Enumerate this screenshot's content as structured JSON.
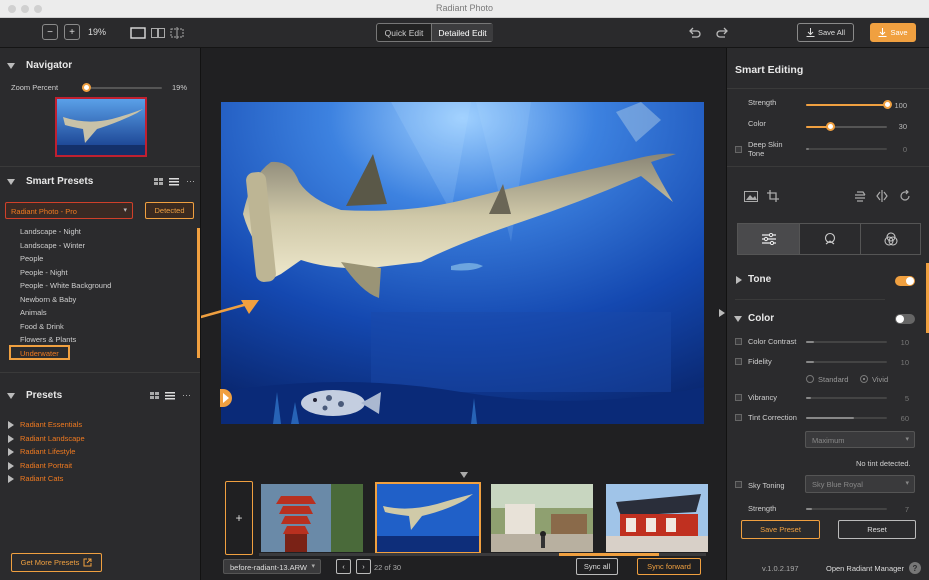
{
  "window": {
    "title": "Radiant Photo"
  },
  "toolbar": {
    "zoom_minus": "−",
    "zoom_plus": "+",
    "zoom_value": "19%",
    "tabs": [
      {
        "label": "Quick Edit"
      },
      {
        "label": "Detailed Edit"
      }
    ],
    "save_all_label": "Save All",
    "save_label": "Save"
  },
  "navigator": {
    "title": "Navigator",
    "zoom_label": "Zoom Percent",
    "zoom_value": "19%",
    "zoom_fraction": 0.19
  },
  "smart_presets": {
    "title": "Smart Presets",
    "dropdown_value": "Radiant Photo - Pro",
    "detected_label": "Detected",
    "items": [
      "Landscape - Night",
      "Landscape - Winter",
      "People",
      "People - Night",
      "People - White Background",
      "Newborn & Baby",
      "Animals",
      "Food & Drink",
      "Flowers & Plants"
    ],
    "selected_item": "Underwater"
  },
  "presets": {
    "title": "Presets",
    "items": [
      "Radiant Essentials",
      "Radiant Landscape",
      "Radiant Lifestyle",
      "Radiant Portrait",
      "Radiant Cats"
    ],
    "more_label": "Get More Presets"
  },
  "filmstrip": {
    "add_label": "+",
    "filename": "before-radiant-13.ARW",
    "counter": "22 of 30",
    "sync_all_label": "Sync all",
    "sync_forward_label": "Sync forward"
  },
  "smart_editing": {
    "title": "Smart Editing",
    "strength": {
      "label": "Strength",
      "value": "100",
      "fraction": 1.0
    },
    "color": {
      "label": "Color",
      "value": "30",
      "fraction": 0.3
    },
    "deep_skin": {
      "label_line1": "Deep Skin",
      "label_line2": "Tone",
      "value": "0"
    }
  },
  "tone": {
    "title": "Tone",
    "enabled": true
  },
  "color_section": {
    "title": "Color",
    "enabled": false,
    "color_contrast": {
      "label": "Color Contrast",
      "value": "10"
    },
    "fidelity": {
      "label": "Fidelity",
      "value": "10"
    },
    "radio_standard": "Standard",
    "radio_vivid": "Vivid",
    "vibrancy": {
      "label": "Vibrancy",
      "value": "5"
    },
    "tint_correction": {
      "label": "Tint Correction",
      "value": "60"
    },
    "tint_select": "Maximum",
    "tint_note": "No tint detected.",
    "sky_toning": {
      "label": "Sky Toning",
      "select": "Sky Blue Royal"
    },
    "sky_strength": {
      "label": "Strength",
      "value": "7"
    }
  },
  "footer": {
    "save_preset_label": "Save Preset",
    "reset_label": "Reset",
    "version": "v.1.0.2.197",
    "open_manager_label": "Open Radiant Manager",
    "help_label": "?"
  },
  "colors": {
    "accent": "#f0a040",
    "accent_dark": "#f07a20",
    "panel": "#2b2b2d"
  }
}
